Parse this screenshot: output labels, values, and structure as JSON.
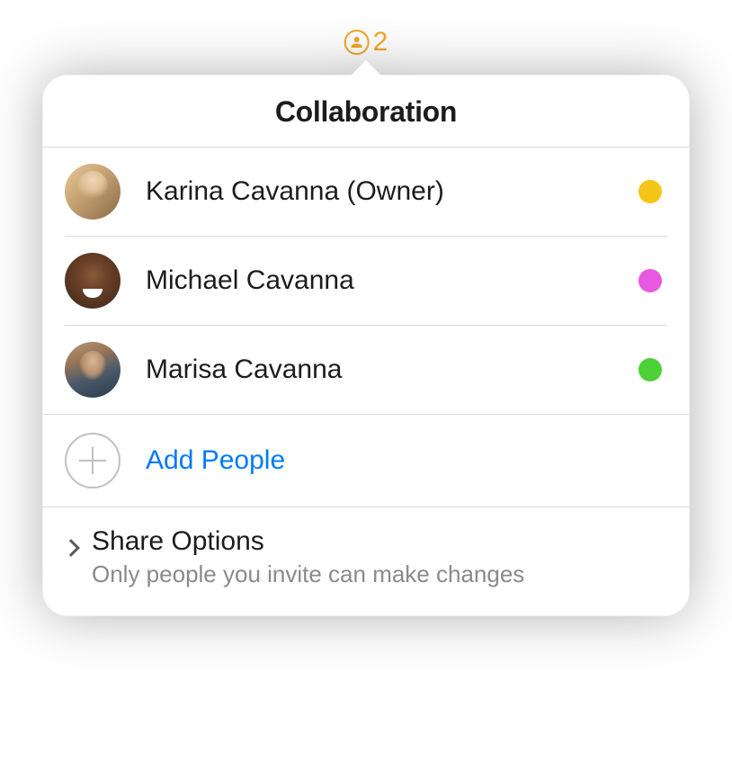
{
  "trigger": {
    "count": "2"
  },
  "header": {
    "title": "Collaboration"
  },
  "people": [
    {
      "name": "Karina Cavanna (Owner)",
      "status_color": "#f5c518"
    },
    {
      "name": "Michael Cavanna",
      "status_color": "#e858e0"
    },
    {
      "name": "Marisa Cavanna",
      "status_color": "#4cd137"
    }
  ],
  "add_people": {
    "label": "Add People"
  },
  "share_options": {
    "title": "Share Options",
    "subtitle": "Only people you invite can make changes"
  },
  "colors": {
    "accent": "#f5a623",
    "link": "#007aff"
  }
}
